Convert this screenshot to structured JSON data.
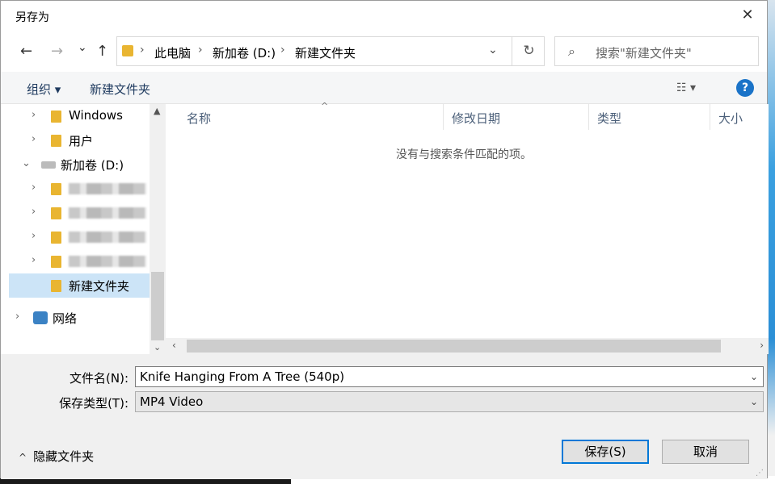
{
  "dialog": {
    "title": "另存为",
    "close_glyph": "✕"
  },
  "nav": {
    "back": "←",
    "forward": "→",
    "recent": "⌄",
    "up": "↑",
    "breadcrumbs": [
      "此电脑",
      "新加卷 (D:)",
      "新建文件夹"
    ],
    "separator": "›",
    "dropdown": "⌄",
    "refresh": "↻"
  },
  "search": {
    "placeholder": "搜索\"新建文件夹\"",
    "icon": "⌕"
  },
  "toolbar": {
    "organize": "组织 ▾",
    "new_folder": "新建文件夹",
    "view_icon": "☷  ▾",
    "help": "?"
  },
  "tree": {
    "items": [
      {
        "label": "Windows",
        "chevron": "›"
      },
      {
        "label": "用户",
        "chevron": "›"
      },
      {
        "label": "新加卷 (D:)",
        "chevron": "⌄"
      },
      {
        "label": "",
        "chevron": "›"
      },
      {
        "label": "",
        "chevron": "›"
      },
      {
        "label": "",
        "chevron": "›"
      },
      {
        "label": "",
        "chevron": "›"
      },
      {
        "label": "新建文件夹",
        "chevron": ""
      },
      {
        "label": "网络",
        "chevron": "›"
      }
    ]
  },
  "list": {
    "columns": [
      "名称",
      "修改日期",
      "类型",
      "大小"
    ],
    "sort_caret": "^",
    "empty_message": "没有与搜索条件匹配的项。"
  },
  "form": {
    "filename_label": "文件名(N):",
    "filename_value": "Knife Hanging From A Tree (540p)",
    "filetype_label": "保存类型(T):",
    "filetype_value": "MP4 Video",
    "dropdown_glyph": "⌄"
  },
  "footer": {
    "hide_folders": "隐藏文件夹",
    "hide_chevron": "^",
    "save": "保存(S)",
    "cancel": "取消"
  },
  "colors": {
    "accent": "#0078d7",
    "folder": "#e9b531",
    "selection": "#cce4f7"
  }
}
